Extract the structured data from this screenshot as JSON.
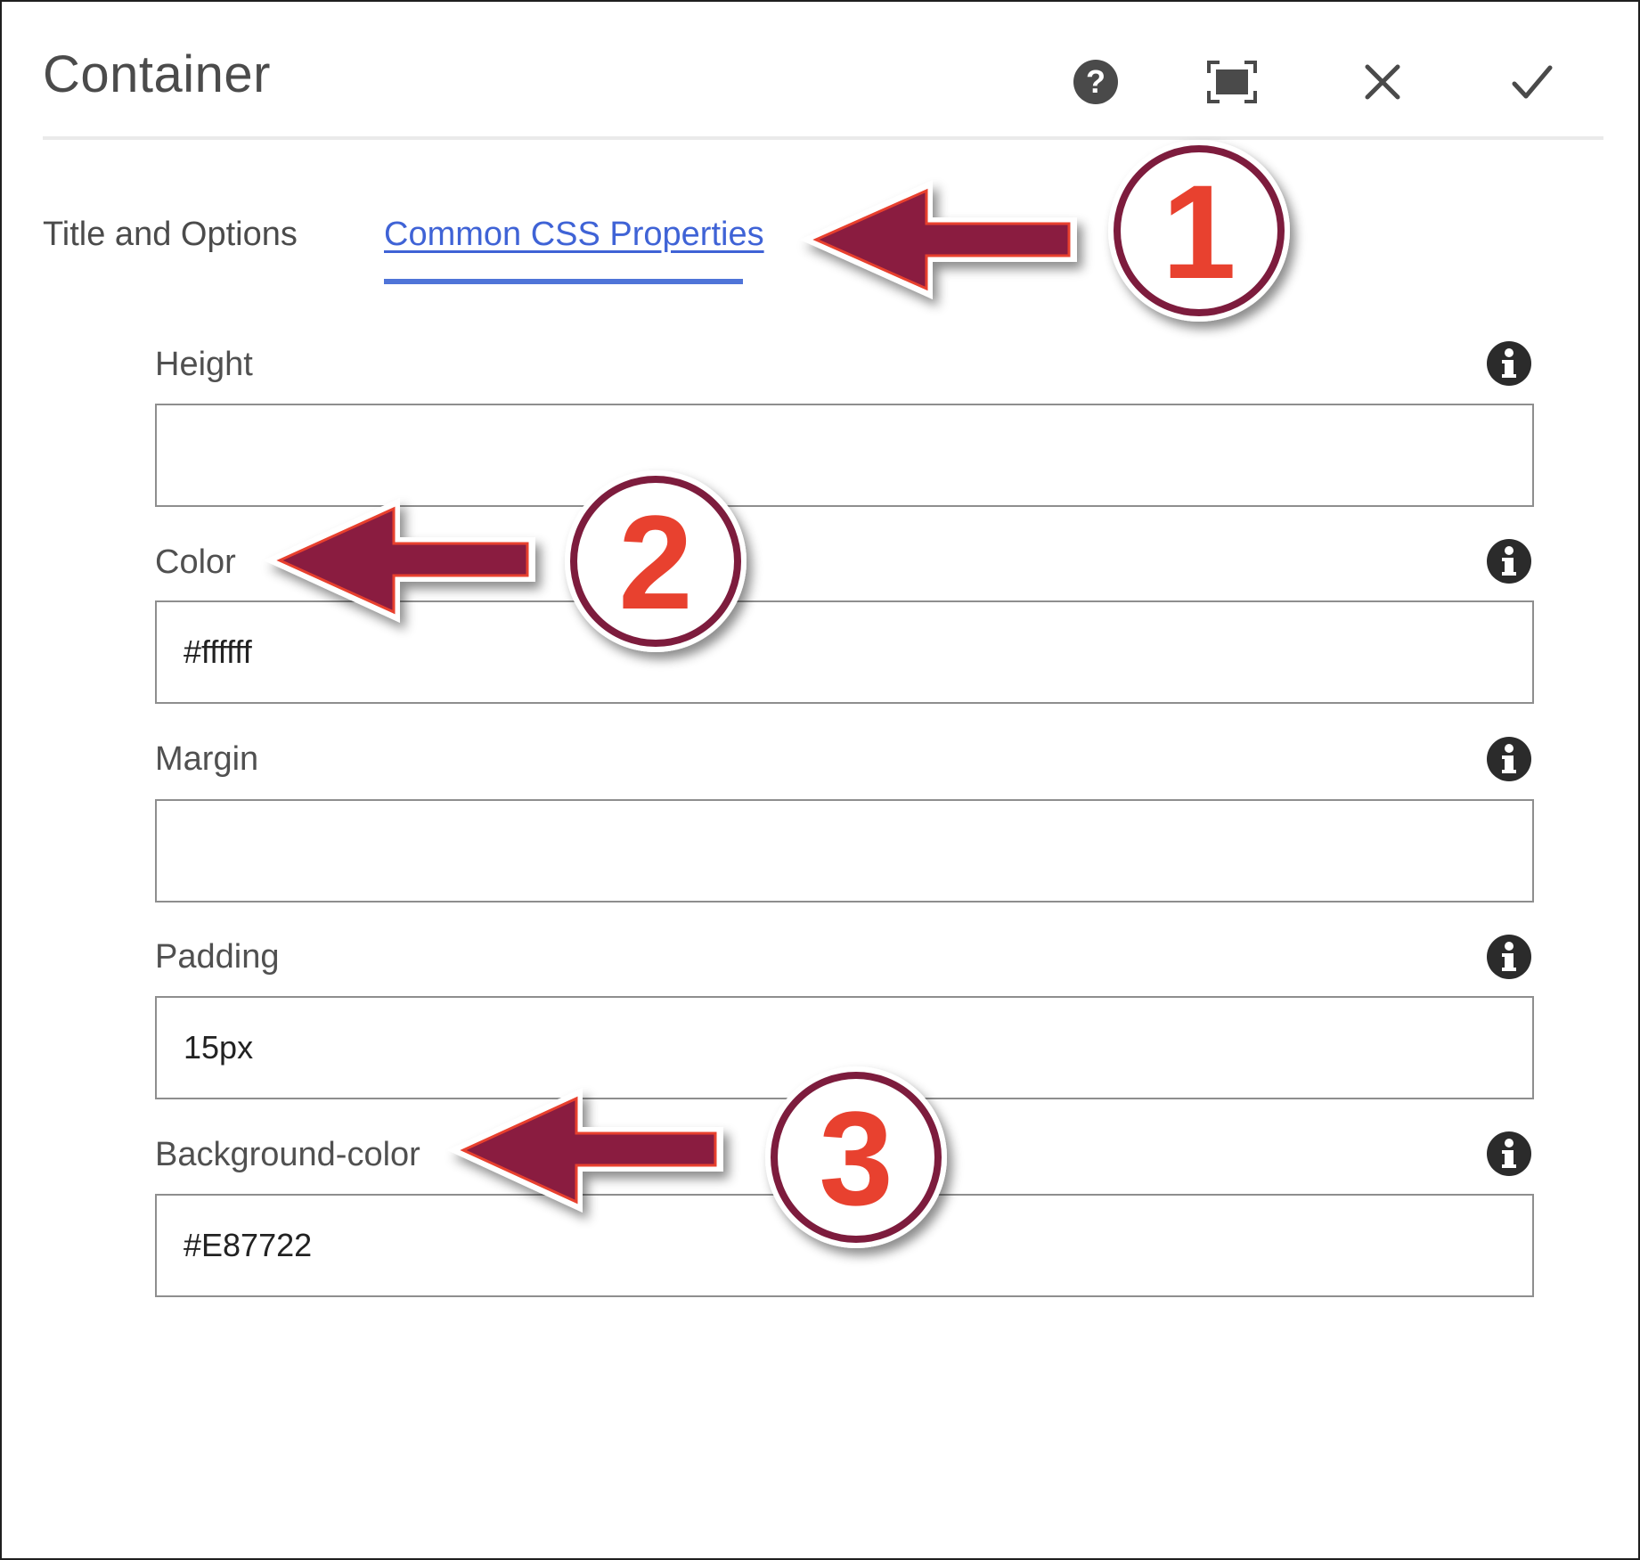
{
  "dialog": {
    "title": "Container"
  },
  "header_actions": {
    "help_icon": "question-circle-icon",
    "fullscreen_icon": "fullscreen-icon",
    "close_icon": "close-icon",
    "done_icon": "checkmark-icon"
  },
  "tabs": [
    {
      "label": "Title and Options",
      "active": false
    },
    {
      "label": "Common CSS Properties",
      "active": true
    }
  ],
  "fields": [
    {
      "label": "Height",
      "value": "",
      "info_icon": "info-icon"
    },
    {
      "label": "Color",
      "value": "#ffffff",
      "info_icon": "info-icon"
    },
    {
      "label": "Margin",
      "value": "",
      "info_icon": "info-icon"
    },
    {
      "label": "Padding",
      "value": "15px",
      "info_icon": "info-icon"
    },
    {
      "label": "Background-color",
      "value": "#E87722",
      "info_icon": "info-icon"
    }
  ],
  "annotations": [
    {
      "number": "1"
    },
    {
      "number": "2"
    },
    {
      "number": "3"
    }
  ],
  "colors": {
    "accent": "#3f63d6",
    "annotation_arrow": "#8a1b40",
    "annotation_number": "#e8412f",
    "annotation_ring": "#7d1b3c"
  }
}
